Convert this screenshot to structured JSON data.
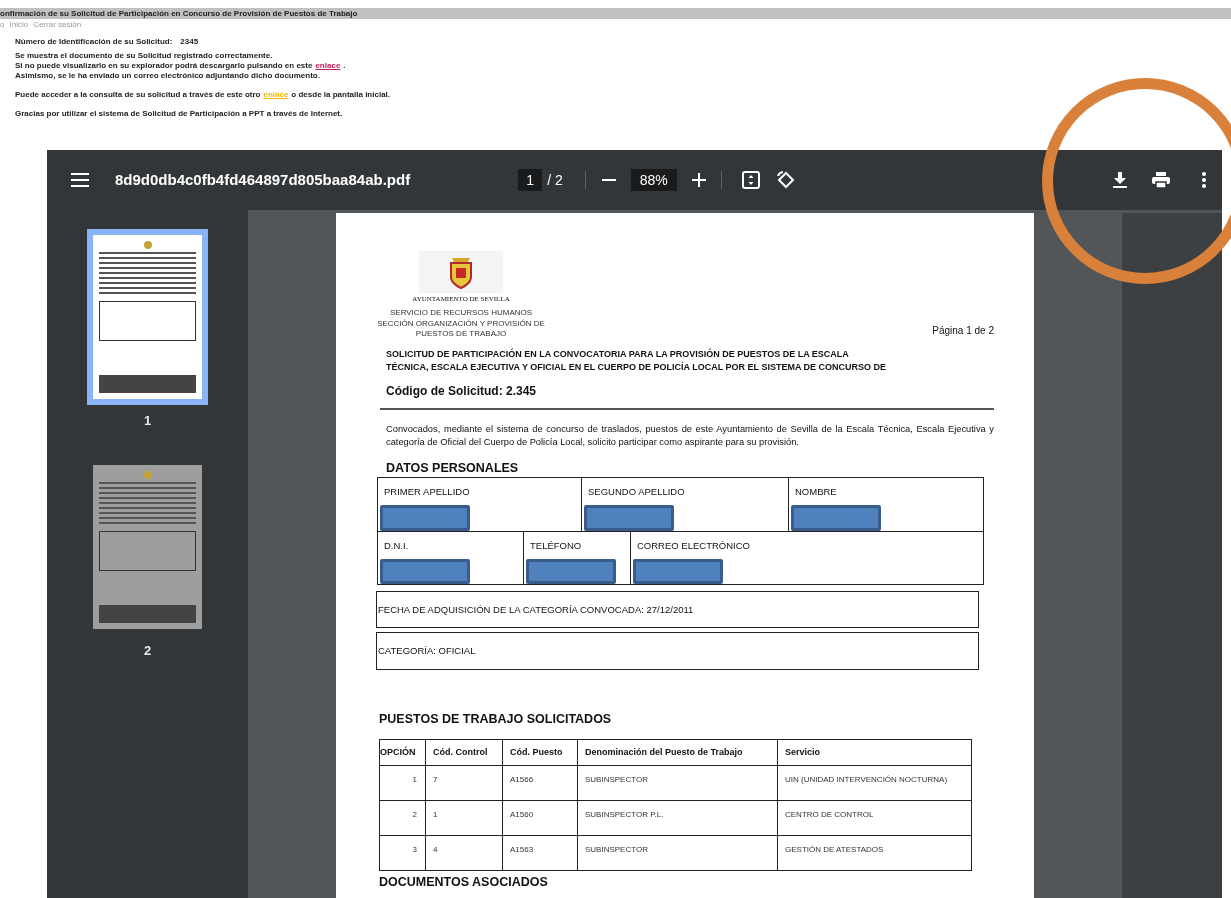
{
  "header": {
    "title": "onfirmación de su Solicitud de Participación en Concurso de Provisión de Puestos de Trabajo",
    "nav": [
      "o",
      "Inicio",
      "Cerrar sesión"
    ]
  },
  "message": {
    "id_label": "Número de Identificación de su Solicitud:",
    "id_value": "2345",
    "lines": [
      {
        "text": "Se muestra el documento de su Solicitud registrado correctamente."
      },
      {
        "text": "Si no puede visualizarlo en su explorador podrá descargarlo pulsando en este",
        "link": "enlace",
        "after": ".",
        "color": "#c2185b"
      },
      {
        "text": "Asimismo, se le ha enviado un correo electrónico adjuntando dicho documento."
      }
    ],
    "consult": {
      "text": "Puede acceder a la consulta de su solicitud a través de este otro",
      "link": "enlace",
      "after": "o desde la pantalla inicial.",
      "color": "#f5b400"
    },
    "thanks": "Gracias por utilizar el sistema de Solicitud de Participación a PPT a través de Internet."
  },
  "viewer": {
    "filename": "8d9d0db4c0fb4fd464897d805baa84ab.pdf",
    "page": "1",
    "page_total": "/ 2",
    "zoom": "88%",
    "thumbnails": [
      {
        "label": "1",
        "selected": true
      },
      {
        "label": "2",
        "selected": false
      }
    ]
  },
  "document": {
    "logo_caption": "AYUNTAMIENTO DE SEVILLA",
    "department": [
      "SERVICIO DE RECURSOS HUMANOS",
      "SECCIÓN ORGANIZACIÓN Y PROVISIÓN DE",
      "PUESTOS DE TRABAJO"
    ],
    "page_label": "Página 1 de 2",
    "title": [
      "SOLICITUD DE PARTICIPACIÓN EN LA CONVOCATORIA PARA LA PROVISIÓN DE PUESTOS DE LA ESCALA",
      "TÉCNICA, ESCALA EJECUTIVA Y OFICIAL EN EL CUERPO DE POLICÍA LOCAL POR EL SISTEMA DE CONCURSO DE"
    ],
    "code": "Código de Solicitud: 2.345",
    "intro": "Convocados, mediante el sistema de concurso de traslados, puestos de este Ayuntamiento de Sevilla de la Escala Técnica, Escala Ejecutiva y categoría de Oficial del Cuerpo de Policía Local, solicito participar como aspirante para su provisión.",
    "personal_heading": "DATOS PERSONALES",
    "personal_rows": [
      [
        "PRIMER APELLIDO",
        "SEGUNDO APELLIDO",
        "NOMBRE"
      ],
      [
        "D.N.I.",
        "TELÉFONO",
        "CORREO ELECTRÓNICO"
      ]
    ],
    "fecha": "FECHA DE ADQUISICIÓN DE LA CATEGORÍA CONVOCADA: 27/12/2011",
    "categoria": "CATEGORÍA: OFICIAL",
    "jobs_heading": "PUESTOS DE TRABAJO SOLICITADOS",
    "jobs_columns": [
      "OPCIÓN",
      "Cód. Control",
      "Cód.  Puesto",
      "Denominación del Puesto de Trabajo",
      "Servicio"
    ],
    "jobs_rows": [
      [
        "1",
        "7",
        "A1566",
        "SUBINSPECTOR",
        "UIN (UNIDAD INTERVENCIÓN NOCTURNA)"
      ],
      [
        "2",
        "1",
        "A1560",
        "SUBINSPECTOR P.L.",
        "CENTRO DE CONTROL"
      ],
      [
        "3",
        "4",
        "A1563",
        "SUBINSPECTOR",
        "GESTIÓN DE ATESTADOS"
      ]
    ],
    "docs_heading": "DOCUMENTOS ASOCIADOS"
  }
}
